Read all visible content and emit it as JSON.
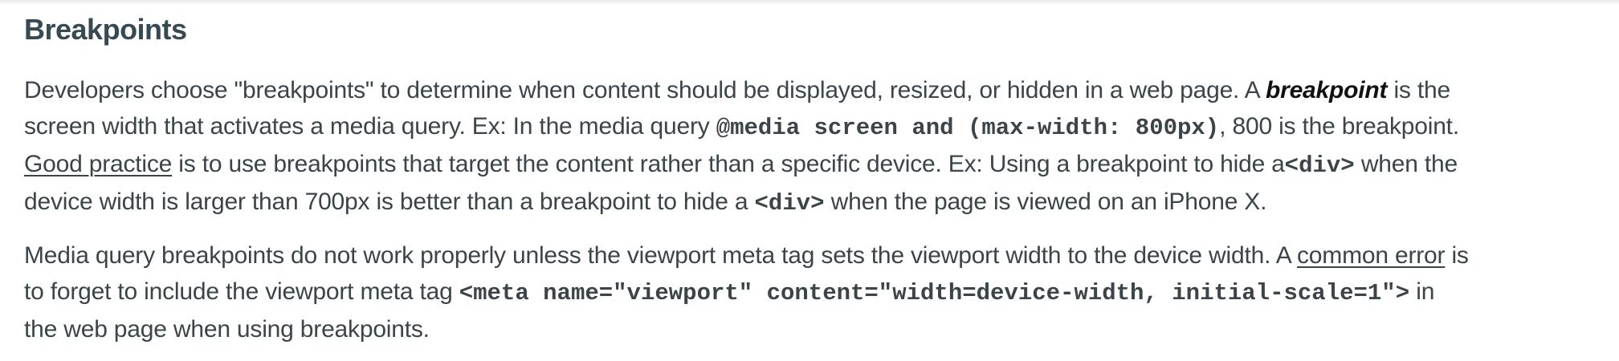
{
  "heading": "Breakpoints",
  "para1": {
    "l1_a": "Developers choose \"breakpoints\" to determine when content should be displayed, resized, or hidden in a web page. A ",
    "l1_term": "breakpoint",
    "l1_b": " is the",
    "l2_a": "screen width that activates a media query. Ex: In the media query ",
    "l2_code": "@media screen and (max-width: 800px)",
    "l2_b": ", 800 is the breakpoint.",
    "l3_link": "Good practice",
    "l3_a": " is to use breakpoints that target the content rather than a specific device. Ex: Using a breakpoint to hide a",
    "l3_code": "<div>",
    "l3_b": " when the",
    "l4_a": "device width is larger than 700px is better than a breakpoint to hide a ",
    "l4_code": "<div>",
    "l4_b": " when the page is viewed on an iPhone X."
  },
  "para2": {
    "l1_a": "Media query breakpoints do not work properly unless the viewport meta tag sets the viewport width to the device width. A ",
    "l1_link": "common error",
    "l1_b": " is",
    "l2_a": "to forget to include the viewport meta tag ",
    "l2_code": "<meta name=\"viewport\" content=\"width=device-width, initial-scale=1\">",
    "l2_b": " in",
    "l3_a": "the web page when using breakpoints."
  }
}
